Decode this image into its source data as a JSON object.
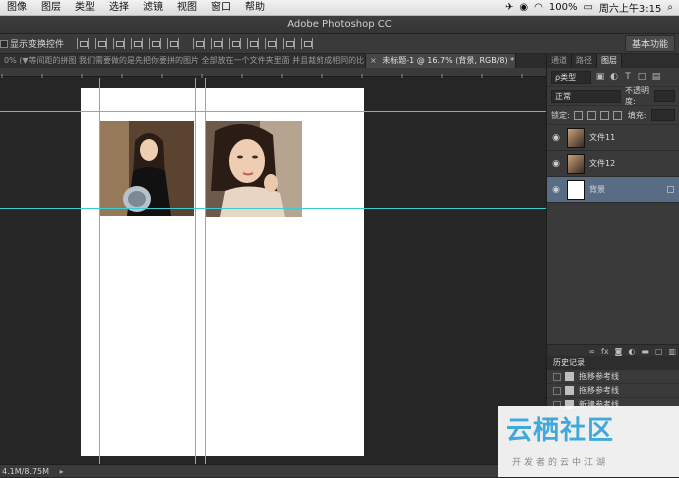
{
  "menubar": {
    "items": [
      "图像",
      "图层",
      "类型",
      "选择",
      "滤镜",
      "视图",
      "窗口",
      "帮助"
    ],
    "status_battery": "100%",
    "datetime": "周六上午3:15"
  },
  "app": {
    "title": "Adobe Photoshop CC"
  },
  "options_bar": {
    "show_transform_label": "显示变换控件",
    "workspace_button": "基本功能"
  },
  "doc_tabs": [
    {
      "label": "0% (▼等间距的拼图 我们需要做的是先把你要拼的图片 全部放在一个文件夹里面 并且裁剪成相同的比..."
    },
    {
      "close": "×",
      "label": "未标题-1 @ 16.7% (背景, RGB/8) *"
    }
  ],
  "status_bar": {
    "doc_size": "4.1M/8.75M",
    "arrow": "▸"
  },
  "panels": {
    "tabs": [
      "通道",
      "路径",
      "图层"
    ],
    "filter_type": "ρ类型",
    "blend_mode": "正常",
    "opacity_label": "不透明度:",
    "lock_label": "锁定:",
    "fill_label": "填充:",
    "layers": [
      {
        "name": "文件11",
        "selected": false
      },
      {
        "name": "文件12",
        "selected": false
      },
      {
        "name": "背景",
        "selected": true
      }
    ]
  },
  "history": {
    "title": "历史记录",
    "items": [
      "拖移参考线",
      "拖移参考线",
      "新建参考线"
    ]
  },
  "watermark": {
    "main": "云栖社区",
    "sub": "开发者的云中江湖"
  },
  "colors": {
    "guide": "#3fcbd6",
    "selected_layer": "#596c86",
    "watermark": "#3fa9dc"
  }
}
